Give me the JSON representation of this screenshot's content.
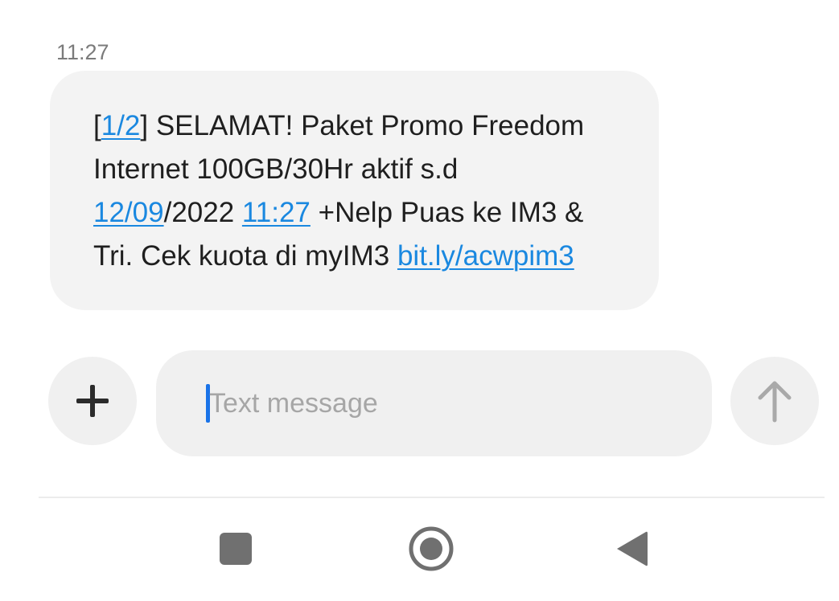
{
  "conversation": {
    "timestamp": "11:27",
    "message": {
      "line1": {
        "open_bracket": "[",
        "link_part": "1/2",
        "rest": "] SELAMAT! Paket Promo Freedom"
      },
      "line2": "Internet 100GB/30Hr aktif s.d",
      "line3": {
        "date_link": "12/09",
        "date_rest": "/2022 ",
        "time_link": "11:27",
        "rest": " +Nelp Puas ke IM3 &"
      },
      "line4": {
        "text": "Tri. Cek kuota di myIM3 ",
        "url_link": "bit.ly/acwpim3"
      }
    }
  },
  "composer": {
    "placeholder": "Text message",
    "value": "",
    "attach_icon": "plus-icon",
    "send_icon": "arrow-up-icon"
  },
  "navbar": {
    "recents_icon": "square-icon",
    "home_icon": "circle-icon",
    "back_icon": "triangle-back-icon"
  },
  "colors": {
    "link": "#1a88e0",
    "bubble": "#f3f3f3",
    "caret": "#1a73e8",
    "text": "#1f1f1f",
    "muted": "#7b7b7b"
  }
}
